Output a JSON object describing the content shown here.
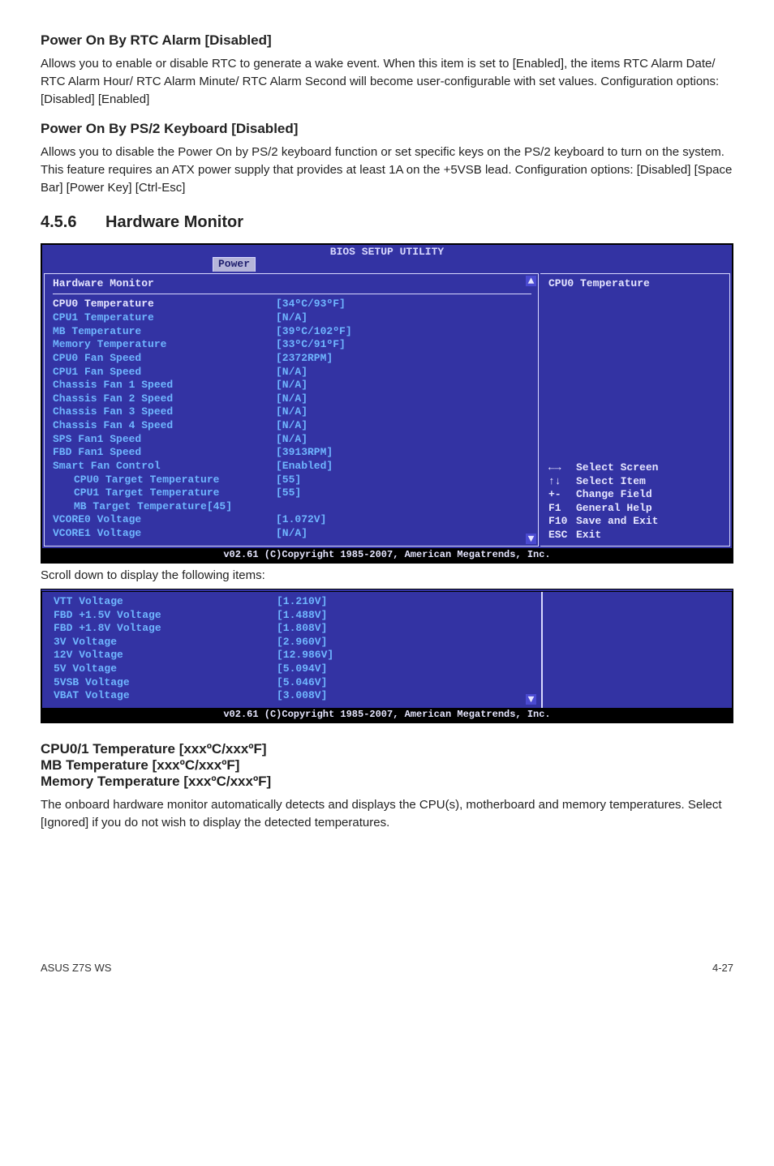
{
  "sections": {
    "rtc": {
      "heading": "Power On By RTC Alarm [Disabled]",
      "text": "Allows you to enable or disable RTC to generate a wake event. When this item is set to [Enabled], the items RTC Alarm Date/ RTC Alarm Hour/ RTC Alarm Minute/ RTC Alarm Second will become user-configurable with set values. Configuration options: [Disabled] [Enabled]"
    },
    "ps2": {
      "heading": "Power On By PS/2 Keyboard [Disabled]",
      "text": "Allows you to disable the Power On by PS/2 keyboard function or set specific keys on the PS/2 keyboard to turn on the system. This feature requires an ATX power supply that provides at least 1A on the +5VSB lead. Configuration options: [Disabled] [Space Bar] [Power Key] [Ctrl-Esc]"
    },
    "hwmon": {
      "num": "4.5.6",
      "title": "Hardware Monitor"
    },
    "cputemp": {
      "line1": "CPU0/1 Temperature [xxxºC/xxxºF]",
      "line2": "MB Temperature [xxxºC/xxxºF]",
      "line3": "Memory Temperature [xxxºC/xxxºF]",
      "text": "The onboard hardware monitor automatically detects and displays the CPU(s), motherboard and memory temperatures. Select [Ignored] if you do not wish to display the detected temperatures."
    }
  },
  "between": "Scroll down to display the following items:",
  "bios1": {
    "title": "BIOS SETUP UTILITY",
    "tab": "Power",
    "panelHeading": "Hardware Monitor",
    "rightHeading": "CPU0 Temperature",
    "rows": [
      {
        "label": "CPU0 Temperature",
        "value": "[34ºC/93ºF]",
        "white": true,
        "indent": false
      },
      {
        "label": "CPU1 Temperature",
        "value": "[N/A]",
        "white": false,
        "indent": false
      },
      {
        "label": "MB Temperature",
        "value": "[39ºC/102ºF]",
        "white": false,
        "indent": false
      },
      {
        "label": "Memory Temperature",
        "value": "[33ºC/91ºF]",
        "white": false,
        "indent": false
      },
      {
        "label": "CPU0 Fan Speed",
        "value": "[2372RPM]",
        "white": false,
        "indent": false
      },
      {
        "label": "CPU1 Fan Speed",
        "value": "[N/A]",
        "white": false,
        "indent": false
      },
      {
        "label": "Chassis Fan 1 Speed",
        "value": "[N/A]",
        "white": false,
        "indent": false
      },
      {
        "label": "Chassis Fan 2 Speed",
        "value": "[N/A]",
        "white": false,
        "indent": false
      },
      {
        "label": "Chassis Fan 3 Speed",
        "value": "[N/A]",
        "white": false,
        "indent": false
      },
      {
        "label": "Chassis Fan 4 Speed",
        "value": "[N/A]",
        "white": false,
        "indent": false
      },
      {
        "label": "SPS Fan1 Speed",
        "value": "[N/A]",
        "white": false,
        "indent": false
      },
      {
        "label": "FBD Fan1 Speed",
        "value": "[3913RPM]",
        "white": false,
        "indent": false
      },
      {
        "label": "Smart Fan Control",
        "value": "[Enabled]",
        "white": false,
        "indent": false
      },
      {
        "label": "CPU0 Target Temperature",
        "value": "[55]",
        "white": false,
        "indent": true
      },
      {
        "label": "CPU1 Target Temperature",
        "value": "[55]",
        "white": false,
        "indent": true
      },
      {
        "label": "MB Target Temperature[45]",
        "value": "",
        "white": false,
        "indent": true
      },
      {
        "label": "VCORE0 Voltage",
        "value": "[1.072V]",
        "white": false,
        "indent": false
      },
      {
        "label": "VCORE1 Voltage",
        "value": "[N/A]",
        "white": false,
        "indent": false
      }
    ],
    "help": [
      {
        "key": "←→",
        "text": "Select Screen",
        "keycls": "arrows-lr"
      },
      {
        "key": "↑↓",
        "text": "Select Item",
        "keycls": "arrows-ud"
      },
      {
        "key": "+-",
        "text": "Change Field"
      },
      {
        "key": "F1",
        "text": "General Help"
      },
      {
        "key": "F10",
        "text": "Save and Exit"
      },
      {
        "key": "ESC",
        "text": "Exit"
      }
    ],
    "footer": "v02.61 (C)Copyright 1985-2007, American Megatrends, Inc."
  },
  "bios2": {
    "rows": [
      {
        "label": "VTT Voltage",
        "value": "[1.210V]"
      },
      {
        "label": "FBD +1.5V Voltage",
        "value": "[1.488V]"
      },
      {
        "label": "FBD +1.8V Voltage",
        "value": "[1.808V]"
      },
      {
        "label": "3V Voltage",
        "value": "[2.960V]"
      },
      {
        "label": "12V Voltage",
        "value": "[12.986V]"
      },
      {
        "label": "5V Voltage",
        "value": "[5.094V]"
      },
      {
        "label": "5VSB Voltage",
        "value": "[5.046V]"
      },
      {
        "label": "VBAT Voltage",
        "value": "[3.008V]"
      }
    ],
    "footer": "v02.61 (C)Copyright 1985-2007, American Megatrends, Inc."
  },
  "pageFooter": {
    "left": "ASUS Z7S WS",
    "right": "4-27"
  }
}
